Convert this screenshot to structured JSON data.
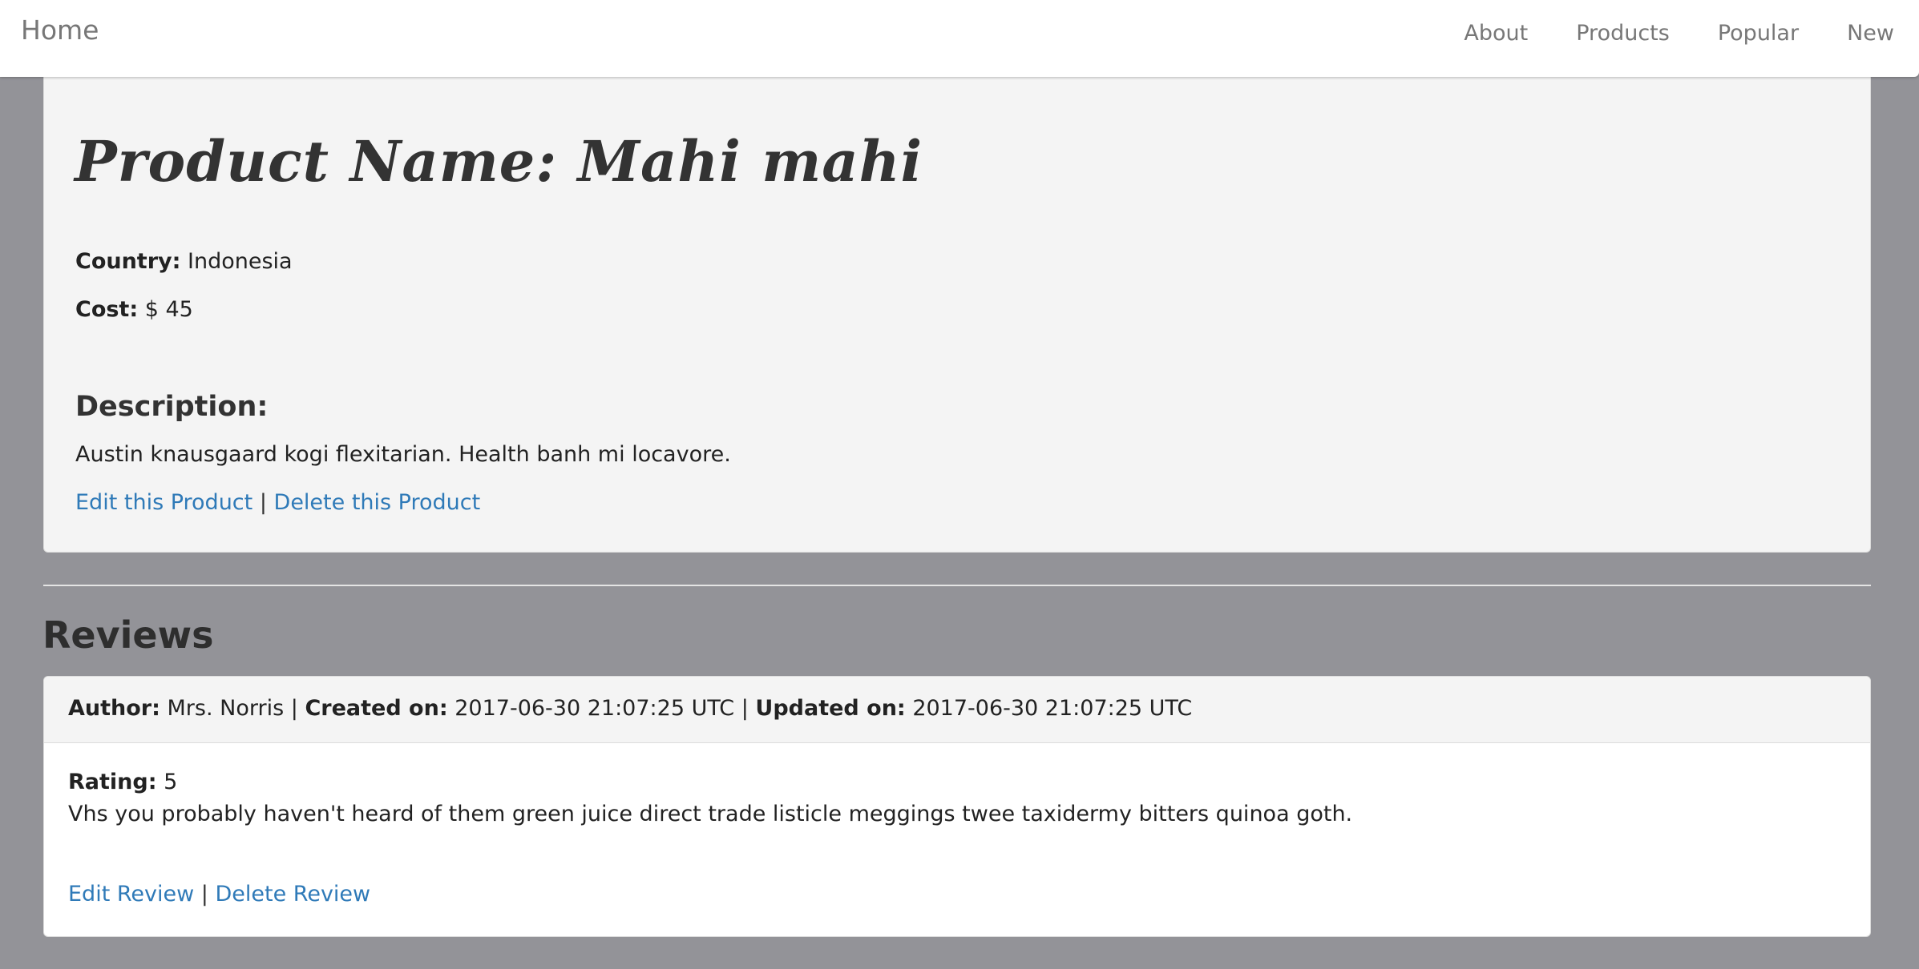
{
  "navbar": {
    "brand": "Home",
    "links": [
      "About",
      "Products",
      "Popular",
      "New"
    ]
  },
  "product": {
    "title": "Product Name: Mahi mahi",
    "country_label": "Country:",
    "country": "Indonesia",
    "cost_label": "Cost:",
    "cost": "$ 45",
    "description_heading": "Description:",
    "description": "Austin knausgaard kogi flexitarian. Health banh mi locavore.",
    "edit_link": "Edit this Product",
    "separator": "|",
    "delete_link": "Delete this Product"
  },
  "reviews": {
    "heading": "Reviews",
    "items": [
      {
        "author_label": "Author:",
        "author": "Mrs. Norris",
        "created_label": "Created on:",
        "created": "2017-06-30 21:07:25 UTC",
        "updated_label": "Updated on:",
        "updated": "2017-06-30 21:07:25 UTC",
        "separator": "|",
        "rating_label": "Rating:",
        "rating": "5",
        "text": "Vhs you probably haven't heard of them green juice direct trade listicle meggings twee taxidermy bitters quinoa goth.",
        "edit_link": "Edit Review",
        "delete_link": "Delete Review"
      }
    ]
  },
  "colors": {
    "page_background": "#939398",
    "panel_background": "#f4f4f4",
    "link": "#2f7ab8",
    "nav_text": "#777777"
  }
}
